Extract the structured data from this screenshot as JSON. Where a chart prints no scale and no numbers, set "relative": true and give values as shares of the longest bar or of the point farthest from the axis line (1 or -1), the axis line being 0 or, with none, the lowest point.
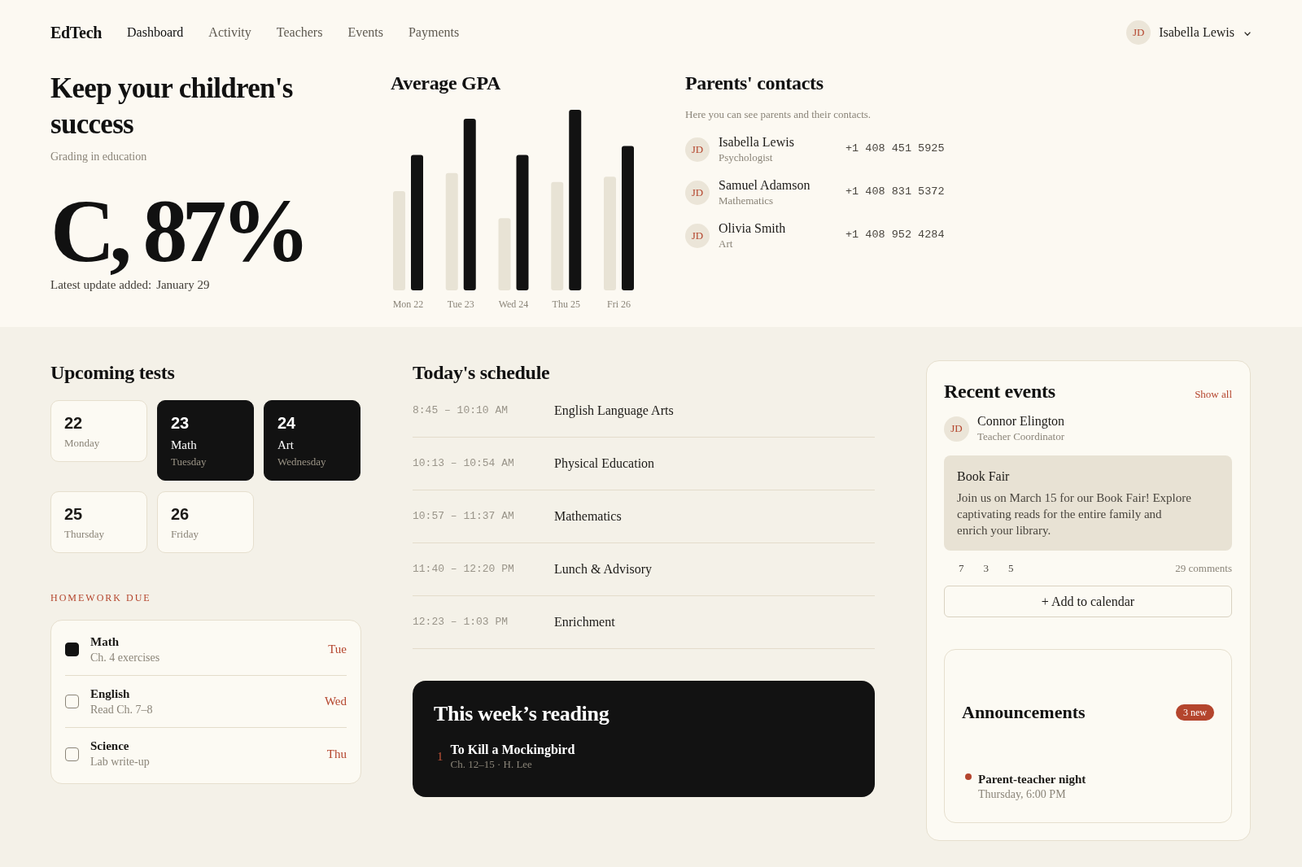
{
  "nav": {
    "brand": "EdTech",
    "links": [
      {
        "label": "Dashboard",
        "selected": true
      },
      {
        "label": "Activity",
        "selected": false
      },
      {
        "label": "Teachers",
        "selected": false
      },
      {
        "label": "Events",
        "selected": false
      },
      {
        "label": "Payments",
        "selected": false
      }
    ],
    "user": {
      "initials": "JD",
      "name": "Isabella Lewis"
    }
  },
  "hero": {
    "title": "Keep your children's success",
    "subtitle": "Grading in education",
    "grade": "C, 87%",
    "update_label": "Latest update added:",
    "update_date": "January 29"
  },
  "gpa": {
    "chart_data": {
      "type": "bar",
      "title": "Average GPA",
      "relative": true,
      "categories": [
        "Mon 22",
        "Tue 23",
        "Wed 24",
        "Thu 25",
        "Fri 26"
      ],
      "series": [
        {
          "color": "#e8e3d5",
          "values": [
            0.55,
            0.65,
            0.4,
            0.6,
            0.63
          ]
        },
        {
          "color": "#121212",
          "values": [
            0.75,
            0.95,
            0.75,
            1.0,
            0.8
          ]
        }
      ]
    }
  },
  "contacts": {
    "title": "Parents' contacts",
    "subtitle": "Here you can see parents and their contacts.",
    "people": [
      {
        "initials": "JD",
        "name": "Isabella Lewis",
        "role": "Psychologist",
        "phone": "+1 408 451 5925"
      },
      {
        "initials": "JD",
        "name": "Samuel Adamson",
        "role": "Mathematics",
        "phone": "+1 408 831 5372"
      },
      {
        "initials": "JD",
        "name": "Olivia Smith",
        "role": "Art",
        "phone": "+1 408 952 4284"
      }
    ]
  },
  "upcoming_tests": {
    "title": "Upcoming tests",
    "days": [
      {
        "day": "22",
        "weekday": "Monday",
        "selected": false
      },
      {
        "day": "23",
        "subject": "Math",
        "weekday": "Tuesday",
        "selected": true
      },
      {
        "day": "24",
        "subject": "Art",
        "weekday": "Wednesday",
        "selected": true
      },
      {
        "day": "25",
        "weekday": "Thursday",
        "selected": false
      },
      {
        "day": "26",
        "weekday": "Friday",
        "selected": false
      }
    ]
  },
  "homework": {
    "title": "HOMEWORK DUE",
    "items": [
      {
        "subject": "Math",
        "task": "Ch. 4 exercises",
        "due": "Tue",
        "checked": true
      },
      {
        "subject": "English",
        "task": "Read Ch. 7–8",
        "due": "Wed",
        "checked": false
      },
      {
        "subject": "Science",
        "task": "Lab write-up",
        "due": "Thu",
        "checked": false
      }
    ]
  },
  "schedule": {
    "title": "Today's schedule",
    "rows": [
      {
        "time": "8:45 – 10:10 AM",
        "subject": "English Language Arts"
      },
      {
        "time": "10:13 – 10:54 AM",
        "subject": "Physical Education"
      },
      {
        "time": "10:57 – 11:37 AM",
        "subject": "Mathematics"
      },
      {
        "time": "11:40 – 12:20 PM",
        "subject": "Lunch & Advisory"
      },
      {
        "time": "12:23 – 1:03 PM",
        "subject": "Enrichment"
      }
    ]
  },
  "reading": {
    "title": "This week’s reading",
    "books": [
      {
        "number": "1",
        "title": "To Kill a Mockingbird",
        "detail": "Ch. 12–15 · H. Lee"
      }
    ]
  },
  "recent_events": {
    "title": "Recent events",
    "link": "Show all",
    "author": {
      "initials": "JD",
      "name": "Connor Elington",
      "role": "Teacher Coordinator"
    },
    "event": {
      "title": "Book Fair",
      "body": "Join us on March 15 for our Book Fair! Explore captivating reads for the entire family and enrich your library."
    },
    "reactions": [
      "7",
      "3",
      "5"
    ],
    "comments": "29 comments",
    "button": "+ Add to calendar"
  },
  "announcements": {
    "title": "Announcements",
    "badge": "3 new",
    "items": [
      {
        "title": "Parent-teacher night",
        "time": "Thursday, 6:00 PM"
      }
    ]
  }
}
